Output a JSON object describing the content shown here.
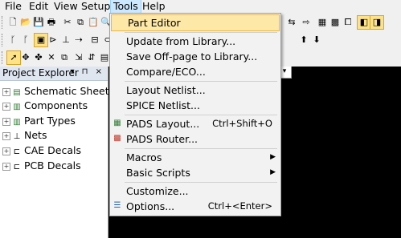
{
  "menubar": {
    "items": [
      {
        "label": "File"
      },
      {
        "label": "Edit"
      },
      {
        "label": "View"
      },
      {
        "label": "Setup"
      },
      {
        "label": "Tools"
      },
      {
        "label": "Help"
      }
    ]
  },
  "panel": {
    "title": "Project Explorer",
    "controls": "▾ ⊓ ×",
    "items": [
      {
        "label": "Schematic Sheets",
        "icon": "sheets-icon"
      },
      {
        "label": "Components",
        "icon": "components-icon"
      },
      {
        "label": "Part Types",
        "icon": "part-types-icon"
      },
      {
        "label": "Nets",
        "icon": "nets-icon"
      },
      {
        "label": "CAE Decals",
        "icon": "cae-decals-icon"
      },
      {
        "label": "PCB Decals",
        "icon": "pcb-decals-icon"
      }
    ]
  },
  "tools_menu": {
    "items": [
      {
        "label": "Part Editor",
        "shortcut": ""
      },
      {
        "label": "Update from Library...",
        "shortcut": ""
      },
      {
        "label": "Save Off-page to Library...",
        "shortcut": ""
      },
      {
        "label": "Compare/ECO...",
        "shortcut": ""
      },
      {
        "label": "Layout Netlist...",
        "shortcut": ""
      },
      {
        "label": "SPICE Netlist...",
        "shortcut": ""
      },
      {
        "label": "PADS Layout...",
        "shortcut": "Ctrl+Shift+O"
      },
      {
        "label": "PADS Router...",
        "shortcut": ""
      },
      {
        "label": "Macros",
        "shortcut": ""
      },
      {
        "label": "Basic Scripts",
        "shortcut": ""
      },
      {
        "label": "Customize...",
        "shortcut": ""
      },
      {
        "label": "Options...",
        "shortcut": "Ctrl+<Enter>"
      }
    ]
  },
  "colors": {
    "menu_highlight": "#fde8a8",
    "canvas": "#000000"
  }
}
